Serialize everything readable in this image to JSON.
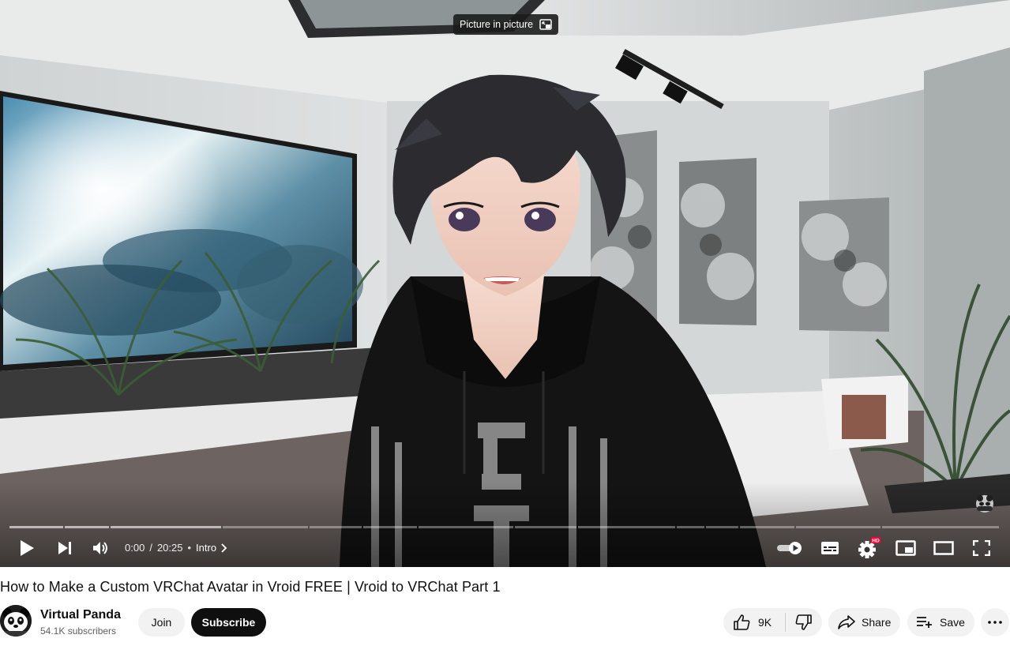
{
  "player": {
    "tooltip": "Picture in picture",
    "time_current": "0:00",
    "time_separator": "/",
    "time_total": "20:25",
    "chapter_separator": "•",
    "chapter": "Intro",
    "progress_fraction": 0.0,
    "buffered_fraction": 0.21,
    "icons": {
      "play": "play-icon",
      "next": "next-icon",
      "volume": "volume-icon",
      "autoplay": "autoplay-toggle-icon",
      "captions": "captions-icon",
      "settings": "settings-icon",
      "settings_badge": "HD",
      "miniplayer": "miniplayer-icon",
      "theater": "theater-mode-icon",
      "fullscreen": "fullscreen-icon"
    }
  },
  "video": {
    "title": "How to Make a Custom VRChat Avatar in Vroid FREE | Vroid to VRChat Part 1"
  },
  "channel": {
    "name": "Virtual Panda",
    "subscribers": "54.1K subscribers",
    "join_label": "Join",
    "subscribe_label": "Subscribe"
  },
  "actions": {
    "likes": "9K",
    "share_label": "Share",
    "save_label": "Save"
  },
  "colors": {
    "subscribe_bg": "#0f0f0f",
    "pill_bg": "#f2f2f2",
    "hd_badge": "#ff0033"
  }
}
